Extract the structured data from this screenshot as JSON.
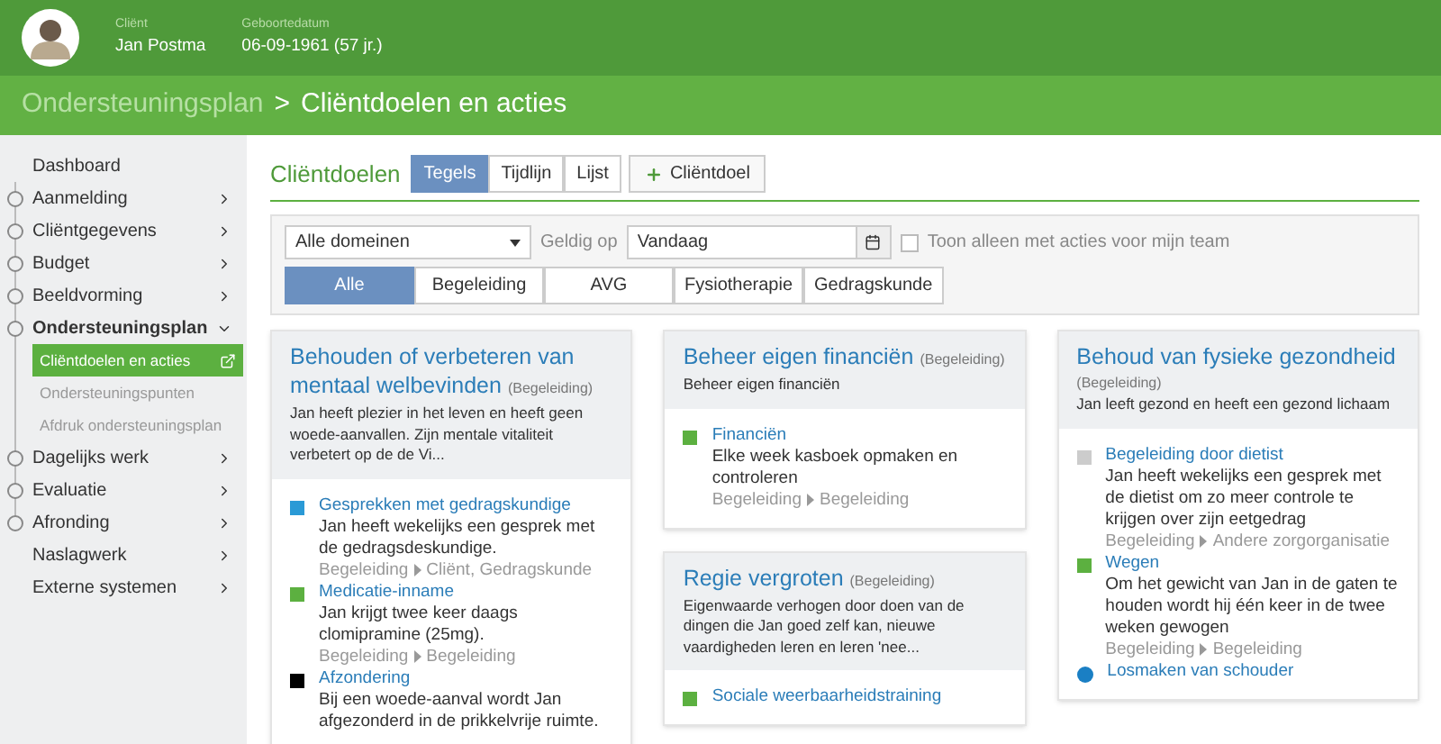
{
  "header": {
    "client_label": "Cliënt",
    "client_name": "Jan Postma",
    "birth_label": "Geboortedatum",
    "birth_value": "06-09-1961 (57 jr.)"
  },
  "breadcrumb": {
    "parent": "Ondersteuningsplan",
    "separator": ">",
    "current": "Cliëntdoelen en acties"
  },
  "sidebar": {
    "items": [
      {
        "label": "Dashboard",
        "kind": "link",
        "bullet": false,
        "expanded": false
      },
      {
        "label": "Aanmelding",
        "kind": "group",
        "bullet": true,
        "expanded": false
      },
      {
        "label": "Cliëntgegevens",
        "kind": "group",
        "bullet": true,
        "expanded": false
      },
      {
        "label": "Budget",
        "kind": "group",
        "bullet": true,
        "expanded": false
      },
      {
        "label": "Beeldvorming",
        "kind": "group",
        "bullet": true,
        "expanded": false
      },
      {
        "label": "Ondersteuningsplan",
        "kind": "group",
        "bullet": true,
        "expanded": true,
        "children": [
          {
            "label": "Cliëntdoelen en acties",
            "selected": true
          },
          {
            "label": "Ondersteuningspunten",
            "selected": false
          },
          {
            "label": "Afdruk ondersteuningsplan",
            "selected": false
          }
        ]
      },
      {
        "label": "Dagelijks werk",
        "kind": "group",
        "bullet": true,
        "expanded": false
      },
      {
        "label": "Evaluatie",
        "kind": "group",
        "bullet": true,
        "expanded": false
      },
      {
        "label": "Afronding",
        "kind": "group",
        "bullet": true,
        "expanded": false
      },
      {
        "label": "Naslagwerk",
        "kind": "group",
        "bullet": false,
        "expanded": false
      },
      {
        "label": "Externe systemen",
        "kind": "group",
        "bullet": false,
        "expanded": false
      }
    ]
  },
  "section": {
    "title": "Cliëntdoelen",
    "views": [
      {
        "label": "Tegels",
        "selected": true
      },
      {
        "label": "Tijdlijn",
        "selected": false
      },
      {
        "label": "Lijst",
        "selected": false
      }
    ],
    "add_button": "Cliëntdoel"
  },
  "filters": {
    "domain": "Alle domeinen",
    "valid_label": "Geldig op",
    "date": "Vandaag",
    "team_only": {
      "label": "Toon alleen met acties voor mijn team",
      "checked": false
    },
    "tabs": [
      {
        "label": "Alle",
        "selected": true
      },
      {
        "label": "Begeleiding",
        "selected": false
      },
      {
        "label": "AVG",
        "selected": false
      },
      {
        "label": "Fysiotherapie",
        "selected": false
      },
      {
        "label": "Gedragskunde",
        "selected": false
      }
    ]
  },
  "columns": [
    [
      {
        "title": "Behouden of verbeteren van mentaal welbevinden",
        "domain": "(Begeleiding)",
        "domain_newline": false,
        "description": "Jan heeft plezier in het leven en heeft geen woede-aanvallen. Zijn mentale vitaliteit verbetert op de de Vi...",
        "actions": [
          {
            "title": "Gesprekken met gedragskundige",
            "kind": "square",
            "color": "#2a9ad6",
            "description": "Jan heeft wekelijks een gesprek met de gedragsdeskundige.",
            "from": "Begeleiding",
            "to": "Cliënt, Gedragskunde"
          },
          {
            "title": "Medicatie-inname",
            "kind": "square",
            "color": "#5cb040",
            "description": "Jan krijgt twee keer daags clomipramine (25mg).",
            "from": "Begeleiding",
            "to": "Begeleiding"
          },
          {
            "title": "Afzondering",
            "kind": "square",
            "color": "#000000",
            "description": "Bij een woede-aanval wordt Jan afgezonderd in de prikkelvrije ruimte."
          }
        ]
      }
    ],
    [
      {
        "title": "Beheer eigen financiën",
        "domain": "(Begeleiding)",
        "domain_newline": false,
        "description": "Beheer eigen financiën",
        "actions": [
          {
            "title": "Financiën",
            "kind": "square",
            "color": "#5cb040",
            "description": "Elke week kasboek opmaken en controleren",
            "from": "Begeleiding",
            "to": "Begeleiding"
          }
        ]
      },
      {
        "title": "Regie vergroten",
        "domain": "(Begeleiding)",
        "domain_newline": false,
        "description": "Eigenwaarde verhogen door doen van de dingen die Jan goed zelf kan, nieuwe vaardigheden leren en leren 'nee...",
        "actions": [
          {
            "title": "Sociale weerbaarheidstraining",
            "kind": "square",
            "color": "#5cb040"
          }
        ]
      }
    ],
    [
      {
        "title": "Behoud van fysieke gezondheid",
        "domain": "(Begeleiding)",
        "domain_newline": true,
        "description": "Jan leeft gezond en heeft een gezond lichaam",
        "actions": [
          {
            "title": "Begeleiding door dietist",
            "kind": "square",
            "color": "#cccccc",
            "description": "Jan heeft wekelijks een gesprek met de dietist om zo meer controle te krijgen over zijn eetgedrag",
            "from": "Begeleiding",
            "to": "Andere zorgorganisatie"
          },
          {
            "title": "Wegen",
            "kind": "square",
            "color": "#5cb040",
            "description": "Om het gewicht van Jan in de gaten te houden wordt hij één keer in de twee weken gewogen",
            "from": "Begeleiding",
            "to": "Begeleiding"
          },
          {
            "title": "Losmaken van schouder",
            "kind": "circle",
            "color": "#1a7fc4"
          }
        ]
      }
    ]
  ]
}
